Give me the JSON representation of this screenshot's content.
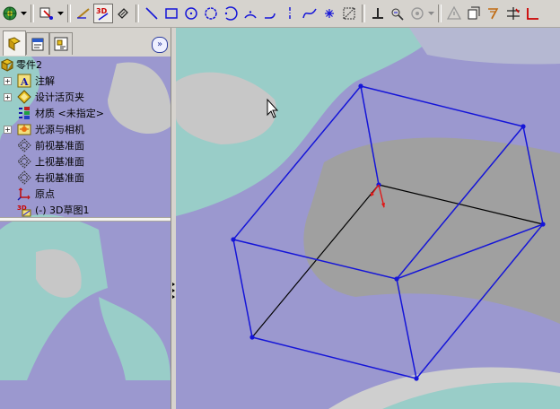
{
  "toolbar": {
    "items": [
      {
        "name": "appearance-icon",
        "dropdown": true
      },
      {
        "name": "display-style-icon",
        "dropdown": true
      },
      {
        "name": "sketch-icon"
      },
      {
        "name": "3d-sketch-icon",
        "active": true
      },
      {
        "name": "smart-dimension-icon"
      },
      {
        "name": "line-icon"
      },
      {
        "name": "rectangle-icon"
      },
      {
        "name": "circle-icon"
      },
      {
        "name": "perimeter-circle-icon"
      },
      {
        "name": "arc-icon"
      },
      {
        "name": "three-point-arc-icon"
      },
      {
        "name": "tangent-arc-icon"
      },
      {
        "name": "centerline-icon"
      },
      {
        "name": "spline-icon"
      },
      {
        "name": "point-icon"
      },
      {
        "name": "plane-icon"
      },
      {
        "name": "add-relation-icon"
      },
      {
        "name": "display-relations-icon"
      },
      {
        "name": "reference-geometry-icon",
        "dropdown": true
      },
      {
        "name": "warning-icon"
      },
      {
        "name": "convert-entities-icon"
      },
      {
        "name": "offset-entities-icon"
      },
      {
        "name": "trim-entities-icon"
      },
      {
        "name": "move-entities-icon"
      }
    ]
  },
  "panel": {
    "tabs": [
      {
        "name": "tab-feature-manager",
        "selected": true
      },
      {
        "name": "tab-property-manager",
        "selected": false
      },
      {
        "name": "tab-configuration-manager",
        "selected": false
      }
    ],
    "collapse_label": "»"
  },
  "tree": {
    "root": "零件2",
    "items": [
      {
        "label": "注解",
        "icon": "annotations-icon",
        "expandable": true
      },
      {
        "label": "设计活页夹",
        "icon": "design-binder-icon",
        "expandable": true
      },
      {
        "label": "材质 <未指定>",
        "icon": "material-icon",
        "expandable": false
      },
      {
        "label": "光源与相机",
        "icon": "lights-cameras-icon",
        "expandable": true
      },
      {
        "label": "前视基准面",
        "icon": "plane-icon",
        "expandable": false
      },
      {
        "label": "上视基准面",
        "icon": "plane-icon",
        "expandable": false
      },
      {
        "label": "右视基准面",
        "icon": "plane-icon",
        "expandable": false
      },
      {
        "label": "原点",
        "icon": "origin-icon",
        "expandable": false
      },
      {
        "label": "(-) 3D草图1",
        "icon": "3d-sketch-icon",
        "expandable": false
      }
    ]
  },
  "colors": {
    "background_purple": "#9b98cf",
    "background_teal": "#99cdc8",
    "background_gray": "#a0a0a0",
    "sketch_blue": "#1515d8",
    "sketch_black": "#000000",
    "origin_red": "#e01818",
    "toolbar_gray": "#d6d3ce"
  }
}
